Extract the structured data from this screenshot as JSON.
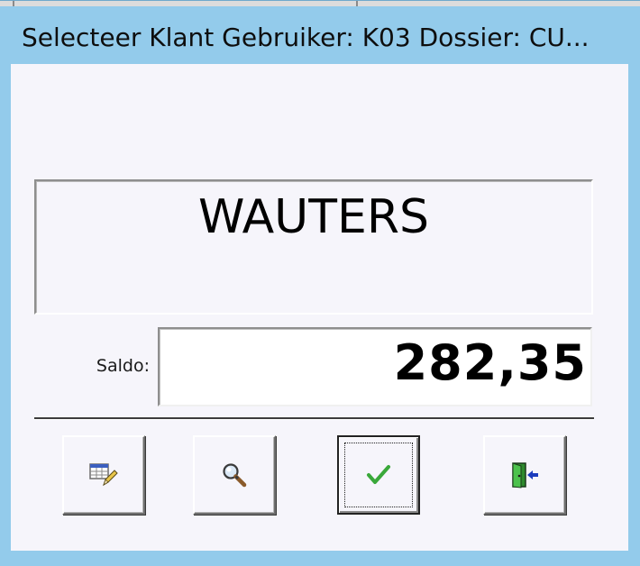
{
  "window": {
    "title": "Selecteer Klant   Gebruiker: K03   Dossier: CU..."
  },
  "client": {
    "name": "WAUTERS"
  },
  "saldo": {
    "label": "Saldo:",
    "value": "282,35"
  },
  "buttons": [
    {
      "icon": "edit-grid-icon"
    },
    {
      "icon": "magnifier-icon"
    },
    {
      "icon": "checkmark-icon"
    },
    {
      "icon": "exit-door-icon"
    }
  ],
  "colors": {
    "frame": "#93cbeb",
    "client_bg": "#f6f5fb",
    "check_green": "#3aa83a",
    "door_green": "#2e8a2e",
    "door_arrow": "#1c3bbd"
  }
}
